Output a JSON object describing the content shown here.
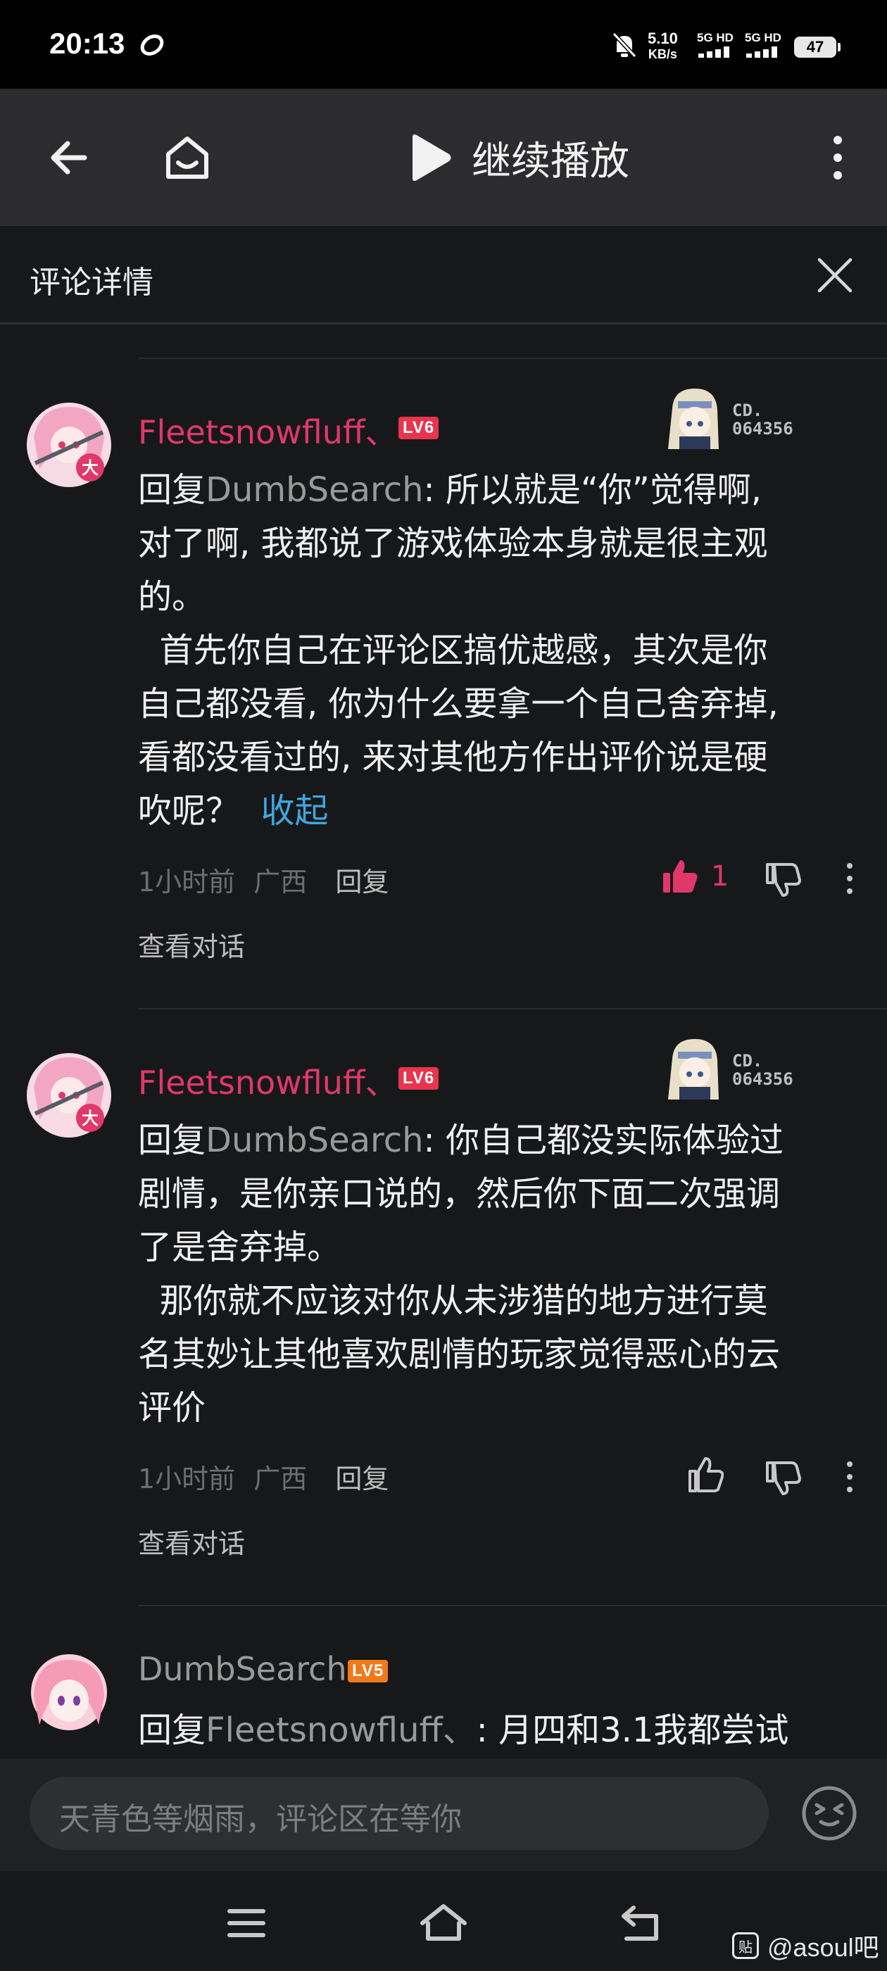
{
  "status_bar": {
    "time": "20:13",
    "speed_value": "5.10",
    "speed_unit": "KB/s",
    "sim1": "5G HD",
    "sim2": "5G HD",
    "battery": "47"
  },
  "toolbar": {
    "play_label": "继续播放"
  },
  "detail": {
    "title": "评论详情"
  },
  "comments": [
    {
      "user": "Fleetsnowfluff、",
      "level": "LV6",
      "badge_no_1": "CD.",
      "badge_no_2": "064356",
      "reply_prefix": "回复",
      "reply_to": "DumbSearch",
      "lines": [
        ": 所以就是“你”觉得啊,",
        "对了啊, 我都说了游戏体验本身就是很主观",
        "的。",
        "  首先你自己在评论区搞优越感，其次是你",
        "自己都没看, 你为什么要拿一个自己舍弃掉,",
        "看都没看过的, 来对其他方作出评价说是硬",
        "吹呢？"
      ],
      "collapse": "收起",
      "time": "1小时前",
      "location": "广西",
      "reply_label": "回复",
      "like_count": "1",
      "view_convo": "查看对话"
    },
    {
      "user": "Fleetsnowfluff、",
      "level": "LV6",
      "badge_no_1": "CD.",
      "badge_no_2": "064356",
      "reply_prefix": "回复",
      "reply_to": "DumbSearch",
      "lines": [
        ": 你自己都没实际体验过",
        "剧情，是你亲口说的，然后你下面二次强调",
        "了是舍弃掉。",
        "  那你就不应该对你从未涉猎的地方进行莫",
        "名其妙让其他喜欢剧情的玩家觉得恶心的云",
        "评价"
      ],
      "time": "1小时前",
      "location": "广西",
      "reply_label": "回复",
      "view_convo": "查看对话"
    },
    {
      "user": "DumbSearch",
      "level": "LV5",
      "reply_prefix": "回复",
      "reply_to": "Fleetsnowfluff、",
      "lines": [
        ": 月四和3.1我都尝试"
      ]
    }
  ],
  "input": {
    "placeholder": "天青色等烟雨，评论区在等你"
  },
  "watermark": {
    "logo": "贴",
    "text": "@asoul吧"
  },
  "colors": {
    "accent_pink": "#e0386a",
    "link_blue": "#3fa7e0",
    "lv6": "#e8344e",
    "lv5": "#f07a1a"
  }
}
